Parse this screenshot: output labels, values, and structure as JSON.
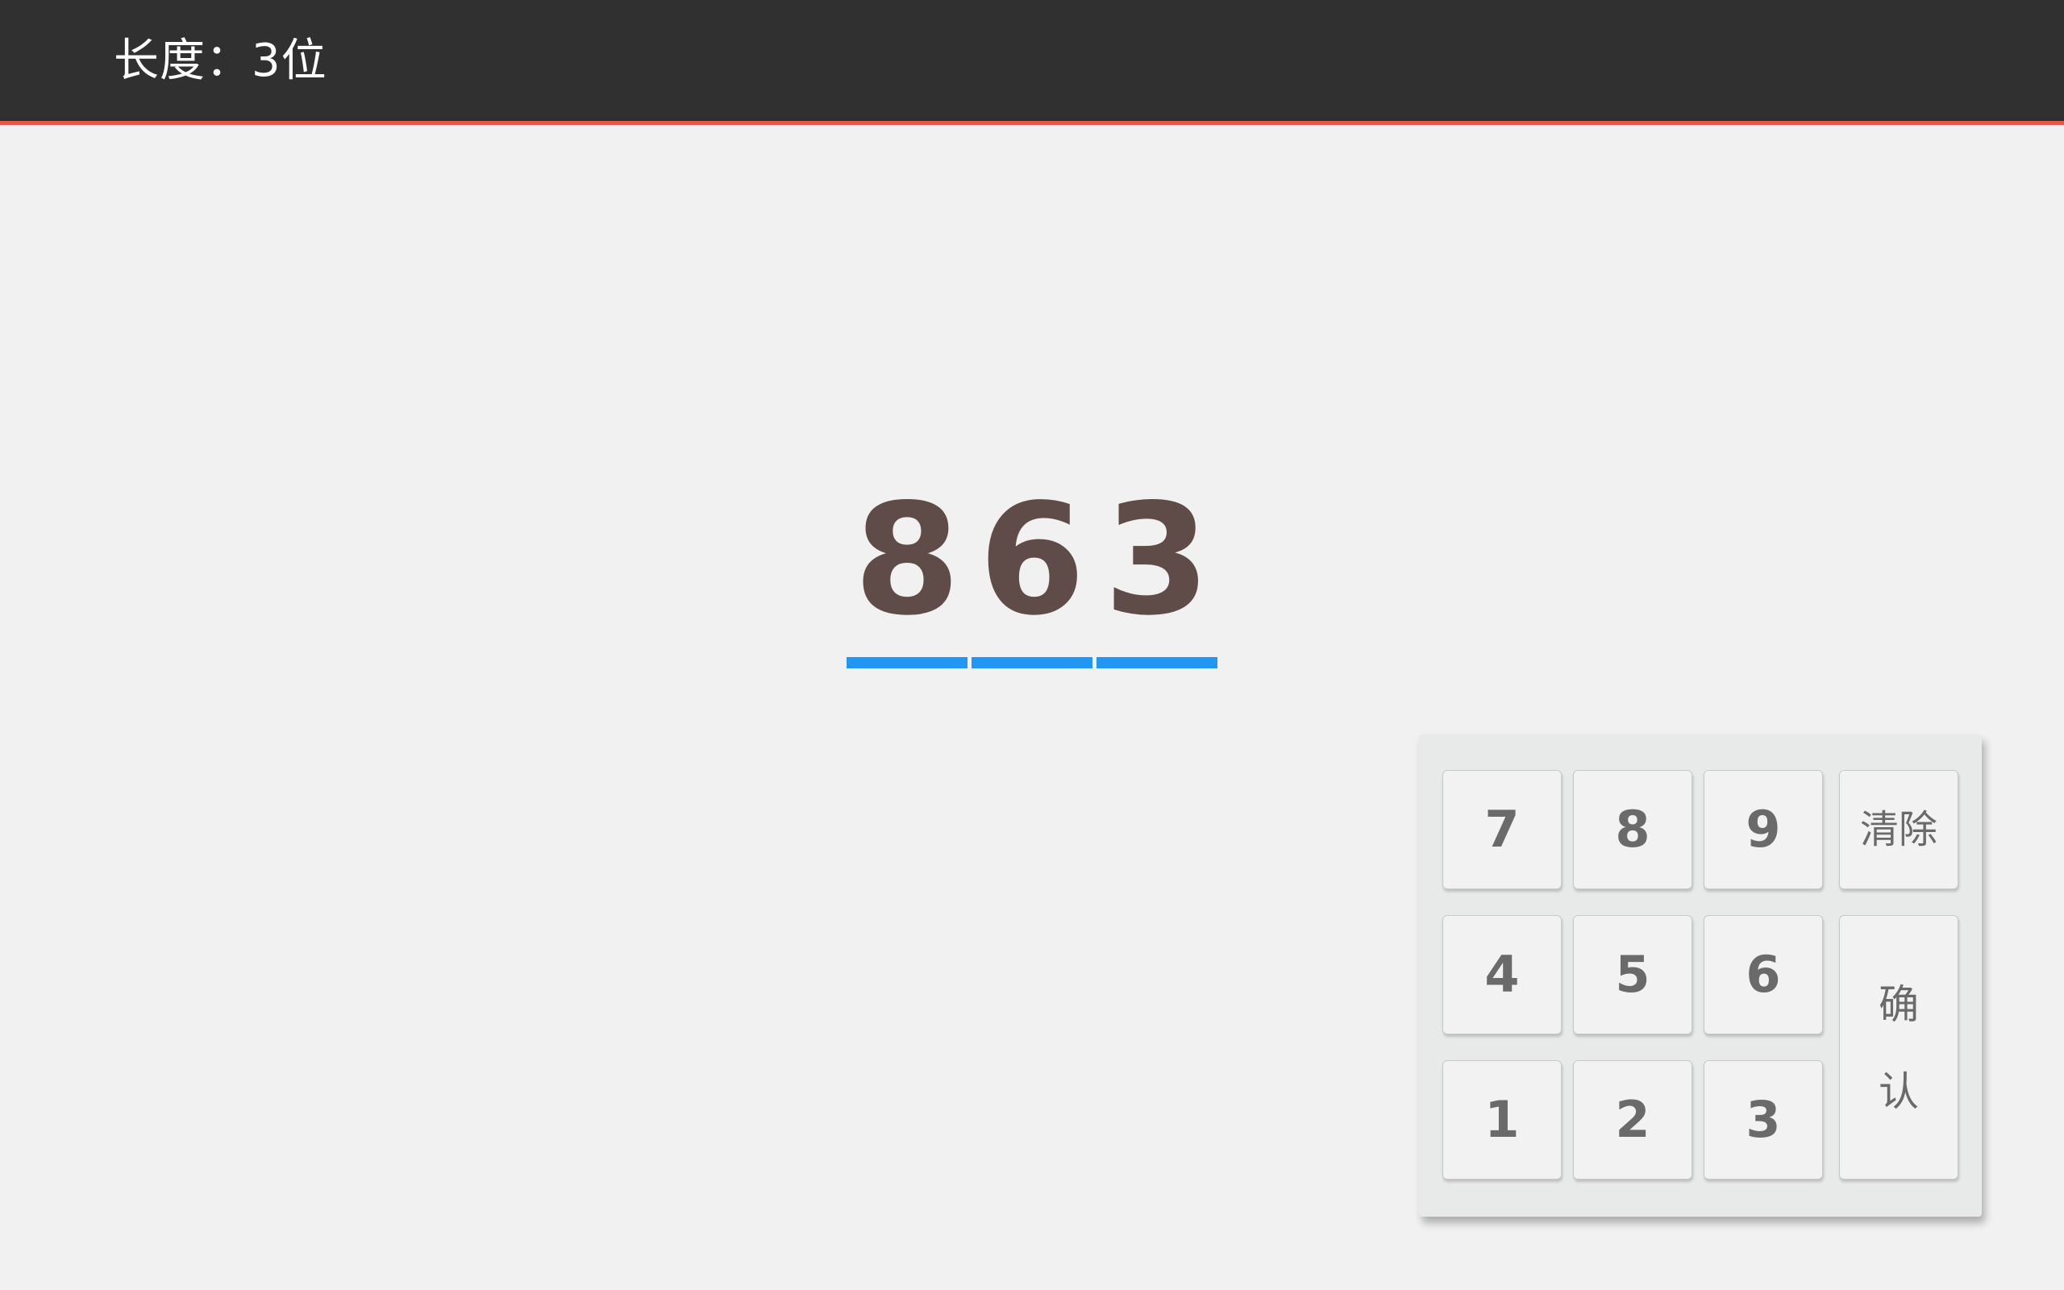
{
  "header": {
    "title": "长度：3位"
  },
  "display": {
    "digits": [
      "8",
      "6",
      "3"
    ],
    "underline_color": "#2196f3",
    "digit_color": "#5f4c48"
  },
  "keypad": {
    "keys": {
      "k7": "7",
      "k8": "8",
      "k9": "9",
      "k4": "4",
      "k5": "5",
      "k6": "6",
      "k1": "1",
      "k2": "2",
      "k3": "3",
      "clear": "清除",
      "confirm_line1": "确",
      "confirm_line2": "认"
    }
  },
  "colors": {
    "header_bg": "#303030",
    "header_accent": "#e05a45",
    "page_bg": "#f0f1f0"
  }
}
